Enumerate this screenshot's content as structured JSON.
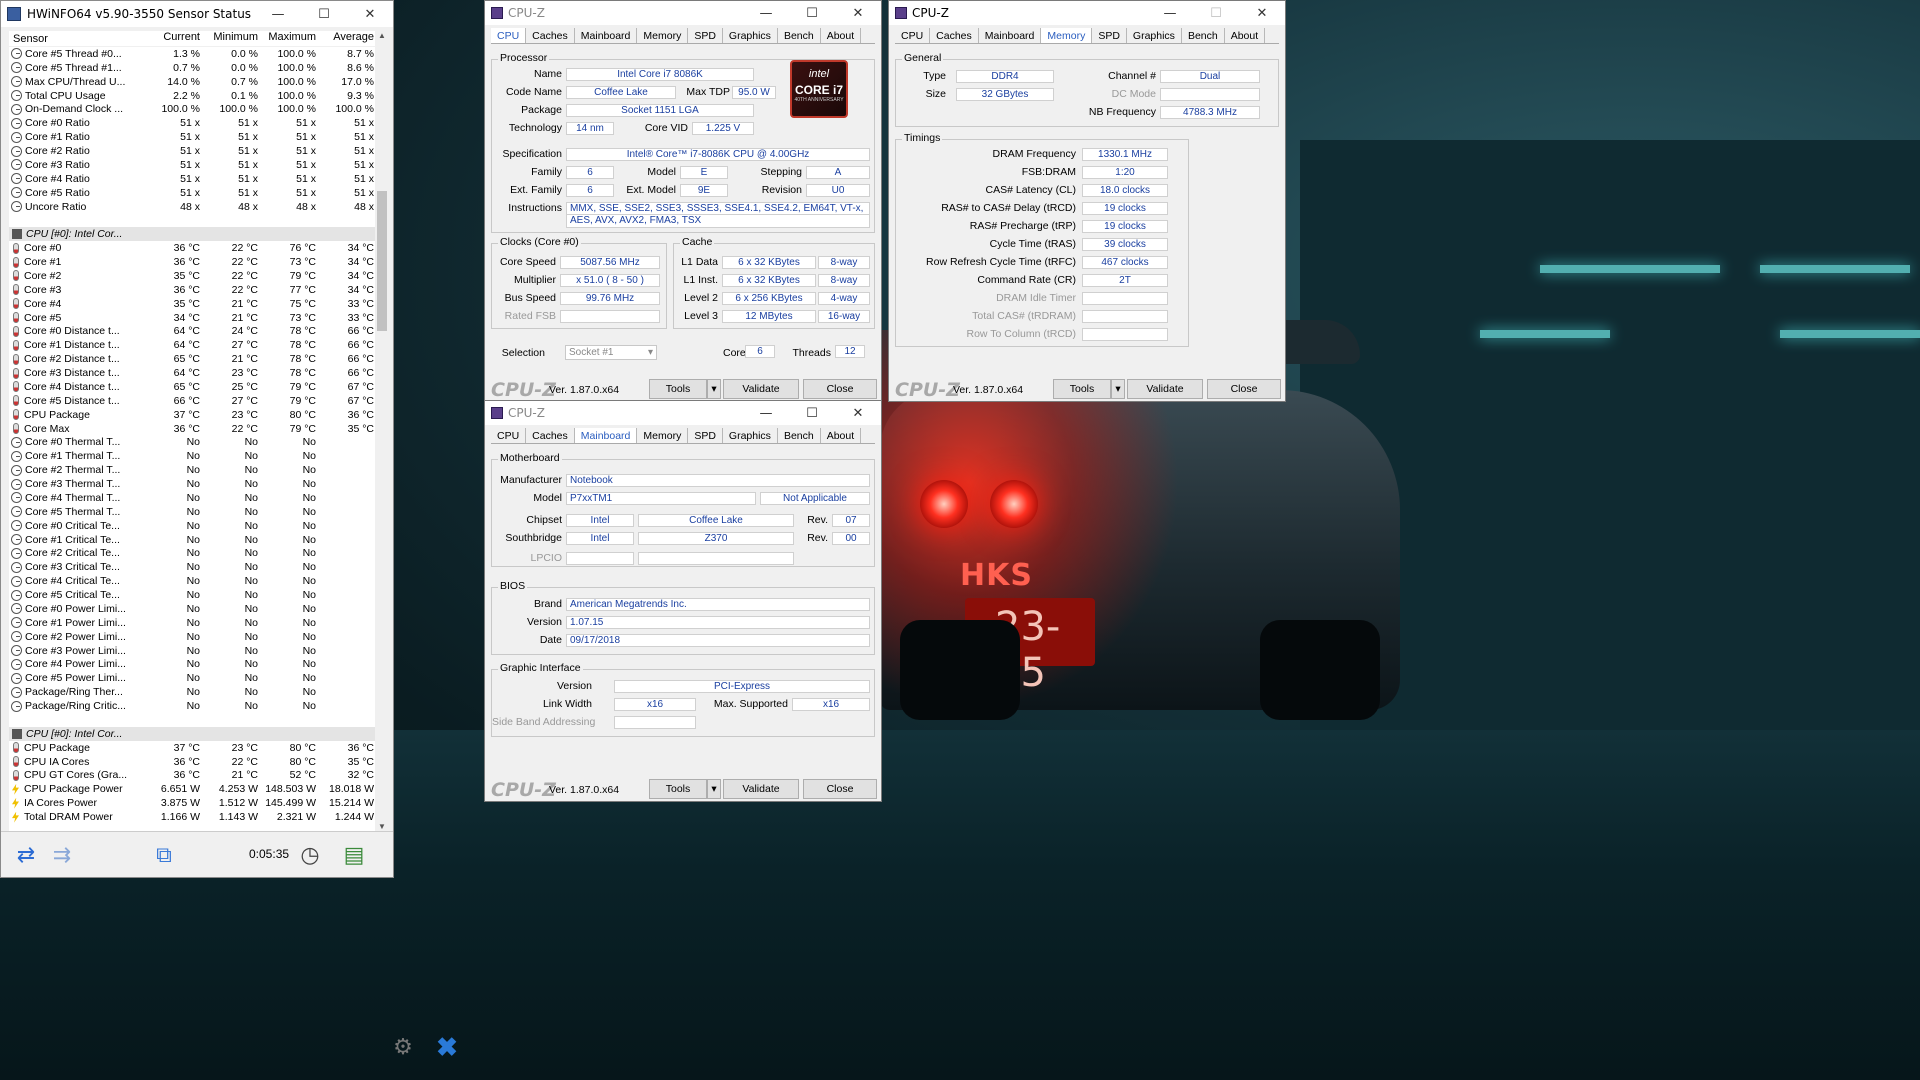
{
  "hwinfo": {
    "title": "HWiNFO64 v5.90-3550 Sensor Status",
    "columns": [
      "Sensor",
      "Current",
      "Minimum",
      "Maximum",
      "Average"
    ],
    "rows": [
      {
        "t": "clock",
        "name": "Core #5 Thread #0...",
        "cur": "1.3 %",
        "min": "0.0 %",
        "max": "100.0 %",
        "avg": "8.7 %"
      },
      {
        "t": "clock",
        "name": "Core #5 Thread #1...",
        "cur": "0.7 %",
        "min": "0.0 %",
        "max": "100.0 %",
        "avg": "8.6 %"
      },
      {
        "t": "clock",
        "name": "Max CPU/Thread U...",
        "cur": "14.0 %",
        "min": "0.7 %",
        "max": "100.0 %",
        "avg": "17.0 %"
      },
      {
        "t": "clock",
        "name": "Total CPU Usage",
        "cur": "2.2 %",
        "min": "0.1 %",
        "max": "100.0 %",
        "avg": "9.3 %"
      },
      {
        "t": "clock",
        "name": "On-Demand Clock ...",
        "cur": "100.0 %",
        "min": "100.0 %",
        "max": "100.0 %",
        "avg": "100.0 %"
      },
      {
        "t": "clock",
        "name": "Core #0 Ratio",
        "cur": "51 x",
        "min": "51 x",
        "max": "51 x",
        "avg": "51 x"
      },
      {
        "t": "clock",
        "name": "Core #1 Ratio",
        "cur": "51 x",
        "min": "51 x",
        "max": "51 x",
        "avg": "51 x"
      },
      {
        "t": "clock",
        "name": "Core #2 Ratio",
        "cur": "51 x",
        "min": "51 x",
        "max": "51 x",
        "avg": "51 x"
      },
      {
        "t": "clock",
        "name": "Core #3 Ratio",
        "cur": "51 x",
        "min": "51 x",
        "max": "51 x",
        "avg": "51 x"
      },
      {
        "t": "clock",
        "name": "Core #4 Ratio",
        "cur": "51 x",
        "min": "51 x",
        "max": "51 x",
        "avg": "51 x"
      },
      {
        "t": "clock",
        "name": "Core #5 Ratio",
        "cur": "51 x",
        "min": "51 x",
        "max": "51 x",
        "avg": "51 x"
      },
      {
        "t": "clock",
        "name": "Uncore Ratio",
        "cur": "48 x",
        "min": "48 x",
        "max": "48 x",
        "avg": "48 x"
      },
      {
        "t": "blank"
      },
      {
        "t": "group",
        "name": "CPU [#0]: Intel Cor..."
      },
      {
        "t": "therm",
        "name": "Core #0",
        "cur": "36 °C",
        "min": "22 °C",
        "max": "76 °C",
        "avg": "34 °C"
      },
      {
        "t": "therm",
        "name": "Core #1",
        "cur": "36 °C",
        "min": "22 °C",
        "max": "73 °C",
        "avg": "34 °C"
      },
      {
        "t": "therm",
        "name": "Core #2",
        "cur": "35 °C",
        "min": "22 °C",
        "max": "79 °C",
        "avg": "34 °C"
      },
      {
        "t": "therm",
        "name": "Core #3",
        "cur": "36 °C",
        "min": "22 °C",
        "max": "77 °C",
        "avg": "34 °C"
      },
      {
        "t": "therm",
        "name": "Core #4",
        "cur": "35 °C",
        "min": "21 °C",
        "max": "75 °C",
        "avg": "33 °C"
      },
      {
        "t": "therm",
        "name": "Core #5",
        "cur": "34 °C",
        "min": "21 °C",
        "max": "73 °C",
        "avg": "33 °C"
      },
      {
        "t": "therm",
        "name": "Core #0 Distance t...",
        "cur": "64 °C",
        "min": "24 °C",
        "max": "78 °C",
        "avg": "66 °C"
      },
      {
        "t": "therm",
        "name": "Core #1 Distance t...",
        "cur": "64 °C",
        "min": "27 °C",
        "max": "78 °C",
        "avg": "66 °C"
      },
      {
        "t": "therm",
        "name": "Core #2 Distance t...",
        "cur": "65 °C",
        "min": "21 °C",
        "max": "78 °C",
        "avg": "66 °C"
      },
      {
        "t": "therm",
        "name": "Core #3 Distance t...",
        "cur": "64 °C",
        "min": "23 °C",
        "max": "78 °C",
        "avg": "66 °C"
      },
      {
        "t": "therm",
        "name": "Core #4 Distance t...",
        "cur": "65 °C",
        "min": "25 °C",
        "max": "79 °C",
        "avg": "67 °C"
      },
      {
        "t": "therm",
        "name": "Core #5 Distance t...",
        "cur": "66 °C",
        "min": "27 °C",
        "max": "79 °C",
        "avg": "67 °C"
      },
      {
        "t": "therm",
        "name": "CPU Package",
        "cur": "37 °C",
        "min": "23 °C",
        "max": "80 °C",
        "avg": "36 °C"
      },
      {
        "t": "therm",
        "name": "Core Max",
        "cur": "36 °C",
        "min": "22 °C",
        "max": "79 °C",
        "avg": "35 °C"
      },
      {
        "t": "clock",
        "name": "Core #0 Thermal T...",
        "cur": "No",
        "min": "No",
        "max": "No",
        "avg": ""
      },
      {
        "t": "clock",
        "name": "Core #1 Thermal T...",
        "cur": "No",
        "min": "No",
        "max": "No",
        "avg": ""
      },
      {
        "t": "clock",
        "name": "Core #2 Thermal T...",
        "cur": "No",
        "min": "No",
        "max": "No",
        "avg": ""
      },
      {
        "t": "clock",
        "name": "Core #3 Thermal T...",
        "cur": "No",
        "min": "No",
        "max": "No",
        "avg": ""
      },
      {
        "t": "clock",
        "name": "Core #4 Thermal T...",
        "cur": "No",
        "min": "No",
        "max": "No",
        "avg": ""
      },
      {
        "t": "clock",
        "name": "Core #5 Thermal T...",
        "cur": "No",
        "min": "No",
        "max": "No",
        "avg": ""
      },
      {
        "t": "clock",
        "name": "Core #0 Critical Te...",
        "cur": "No",
        "min": "No",
        "max": "No",
        "avg": ""
      },
      {
        "t": "clock",
        "name": "Core #1 Critical Te...",
        "cur": "No",
        "min": "No",
        "max": "No",
        "avg": ""
      },
      {
        "t": "clock",
        "name": "Core #2 Critical Te...",
        "cur": "No",
        "min": "No",
        "max": "No",
        "avg": ""
      },
      {
        "t": "clock",
        "name": "Core #3 Critical Te...",
        "cur": "No",
        "min": "No",
        "max": "No",
        "avg": ""
      },
      {
        "t": "clock",
        "name": "Core #4 Critical Te...",
        "cur": "No",
        "min": "No",
        "max": "No",
        "avg": ""
      },
      {
        "t": "clock",
        "name": "Core #5 Critical Te...",
        "cur": "No",
        "min": "No",
        "max": "No",
        "avg": ""
      },
      {
        "t": "clock",
        "name": "Core #0 Power Limi...",
        "cur": "No",
        "min": "No",
        "max": "No",
        "avg": ""
      },
      {
        "t": "clock",
        "name": "Core #1 Power Limi...",
        "cur": "No",
        "min": "No",
        "max": "No",
        "avg": ""
      },
      {
        "t": "clock",
        "name": "Core #2 Power Limi...",
        "cur": "No",
        "min": "No",
        "max": "No",
        "avg": ""
      },
      {
        "t": "clock",
        "name": "Core #3 Power Limi...",
        "cur": "No",
        "min": "No",
        "max": "No",
        "avg": ""
      },
      {
        "t": "clock",
        "name": "Core #4 Power Limi...",
        "cur": "No",
        "min": "No",
        "max": "No",
        "avg": ""
      },
      {
        "t": "clock",
        "name": "Core #5 Power Limi...",
        "cur": "No",
        "min": "No",
        "max": "No",
        "avg": ""
      },
      {
        "t": "clock",
        "name": "Package/Ring Ther...",
        "cur": "No",
        "min": "No",
        "max": "No",
        "avg": ""
      },
      {
        "t": "clock",
        "name": "Package/Ring Critic...",
        "cur": "No",
        "min": "No",
        "max": "No",
        "avg": ""
      },
      {
        "t": "blank"
      },
      {
        "t": "group",
        "name": "CPU [#0]: Intel Cor..."
      },
      {
        "t": "therm",
        "name": "CPU Package",
        "cur": "37 °C",
        "min": "23 °C",
        "max": "80 °C",
        "avg": "36 °C"
      },
      {
        "t": "therm",
        "name": "CPU IA Cores",
        "cur": "36 °C",
        "min": "22 °C",
        "max": "80 °C",
        "avg": "35 °C"
      },
      {
        "t": "therm",
        "name": "CPU GT Cores (Gra...",
        "cur": "36 °C",
        "min": "21 °C",
        "max": "52 °C",
        "avg": "32 °C"
      },
      {
        "t": "bolt",
        "name": "CPU Package Power",
        "cur": "6.651 W",
        "min": "4.253 W",
        "max": "148.503 W",
        "avg": "18.018 W"
      },
      {
        "t": "bolt",
        "name": "IA Cores Power",
        "cur": "3.875 W",
        "min": "1.512 W",
        "max": "145.499 W",
        "avg": "15.214 W"
      },
      {
        "t": "bolt",
        "name": "Total DRAM Power",
        "cur": "1.166 W",
        "min": "1.143 W",
        "max": "2.321 W",
        "avg": "1.244 W"
      }
    ],
    "timer": "0:05:35"
  },
  "cpuz_common": {
    "title": "CPU-Z",
    "logo": "CPU-Z",
    "version": "Ver. 1.87.0.x64",
    "tools": "Tools",
    "validate": "Validate",
    "close": "Close",
    "tabs": [
      "CPU",
      "Caches",
      "Mainboard",
      "Memory",
      "SPD",
      "Graphics",
      "Bench",
      "About"
    ]
  },
  "cpu": {
    "processor": "Processor",
    "name_l": "Name",
    "name": "Intel Core i7 8086K",
    "code_l": "Code Name",
    "code": "Coffee Lake",
    "tdp_l": "Max TDP",
    "tdp": "95.0 W",
    "pkg_l": "Package",
    "pkg": "Socket 1151 LGA",
    "tech_l": "Technology",
    "tech": "14 nm",
    "vid_l": "Core VID",
    "vid": "1.225 V",
    "spec_l": "Specification",
    "spec": "Intel® Core™ i7-8086K CPU @ 4.00GHz",
    "fam_l": "Family",
    "fam": "6",
    "model_l": "Model",
    "model": "E",
    "step_l": "Stepping",
    "step": "A",
    "efam_l": "Ext. Family",
    "efam": "6",
    "emodel_l": "Ext. Model",
    "emodel": "9E",
    "rev_l": "Revision",
    "rev": "U0",
    "instr_l": "Instructions",
    "instr1": "MMX, SSE, SSE2, SSE3, SSSE3, SSE4.1, SSE4.2, EM64T, VT-x,",
    "instr2": "AES, AVX, AVX2, FMA3, TSX",
    "clocks": "Clocks (Core #0)",
    "cspeed_l": "Core Speed",
    "cspeed": "5087.56 MHz",
    "mult_l": "Multiplier",
    "mult": "x 51.0 ( 8 - 50 )",
    "bus_l": "Bus Speed",
    "bus": "99.76 MHz",
    "fsb_l": "Rated FSB",
    "cache": "Cache",
    "l1d_l": "L1 Data",
    "l1d": "6 x 32 KBytes",
    "l1d_w": "8-way",
    "l1i_l": "L1 Inst.",
    "l1i": "6 x 32 KBytes",
    "l1i_w": "8-way",
    "l2_l": "Level 2",
    "l2": "6 x 256 KBytes",
    "l2_w": "4-way",
    "l3_l": "Level 3",
    "l3": "12 MBytes",
    "l3_w": "16-way",
    "sel_l": "Selection",
    "sel": "Socket #1",
    "cores_l": "Cores",
    "cores": "6",
    "threads_l": "Threads",
    "threads": "12",
    "intel1": "intel",
    "intel2": "CORE i7",
    "intel3": "40TH ANNIVERSARY"
  },
  "mem": {
    "general": "General",
    "type_l": "Type",
    "type": "DDR4",
    "chan_l": "Channel #",
    "chan": "Dual",
    "size_l": "Size",
    "size": "32 GBytes",
    "dc_l": "DC Mode",
    "nb_l": "NB Frequency",
    "nb": "4788.3 MHz",
    "timings": "Timings",
    "rows": [
      {
        "l": "DRAM Frequency",
        "v": "1330.1 MHz",
        "dim": false
      },
      {
        "l": "FSB:DRAM",
        "v": "1:20",
        "dim": false
      },
      {
        "l": "CAS# Latency (CL)",
        "v": "18.0 clocks",
        "dim": false
      },
      {
        "l": "RAS# to CAS# Delay (tRCD)",
        "v": "19 clocks",
        "dim": false
      },
      {
        "l": "RAS# Precharge (tRP)",
        "v": "19 clocks",
        "dim": false
      },
      {
        "l": "Cycle Time (tRAS)",
        "v": "39 clocks",
        "dim": false
      },
      {
        "l": "Row Refresh Cycle Time (tRFC)",
        "v": "467 clocks",
        "dim": false
      },
      {
        "l": "Command Rate (CR)",
        "v": "2T",
        "dim": false
      },
      {
        "l": "DRAM Idle Timer",
        "v": "",
        "dim": true
      },
      {
        "l": "Total CAS# (tRDRAM)",
        "v": "",
        "dim": true
      },
      {
        "l": "Row To Column (tRCD)",
        "v": "",
        "dim": true
      }
    ]
  },
  "mb": {
    "motherboard": "Motherboard",
    "man_l": "Manufacturer",
    "man": "Notebook",
    "model_l": "Model",
    "model": "P7xxTM1",
    "model2": "Not Applicable",
    "chip_l": "Chipset",
    "chip": "Intel",
    "chip2": "Coffee Lake",
    "chiprev_l": "Rev.",
    "chiprev": "07",
    "sb_l": "Southbridge",
    "sb": "Intel",
    "sb2": "Z370",
    "sbrev_l": "Rev.",
    "sbrev": "00",
    "lpcio_l": "LPCIO",
    "bios": "BIOS",
    "brand_l": "Brand",
    "brand": "American Megatrends Inc.",
    "ver_l": "Version",
    "ver": "1.07.15",
    "date_l": "Date",
    "date": "09/17/2018",
    "gi": "Graphic Interface",
    "giver_l": "Version",
    "giver": "PCI-Express",
    "lw_l": "Link Width",
    "lw": "x16",
    "ms_l": "Max. Supported",
    "ms": "x16",
    "sba_l": "Side Band Addressing"
  },
  "wall": {
    "hks": "HKS",
    "plate": "23-15"
  }
}
